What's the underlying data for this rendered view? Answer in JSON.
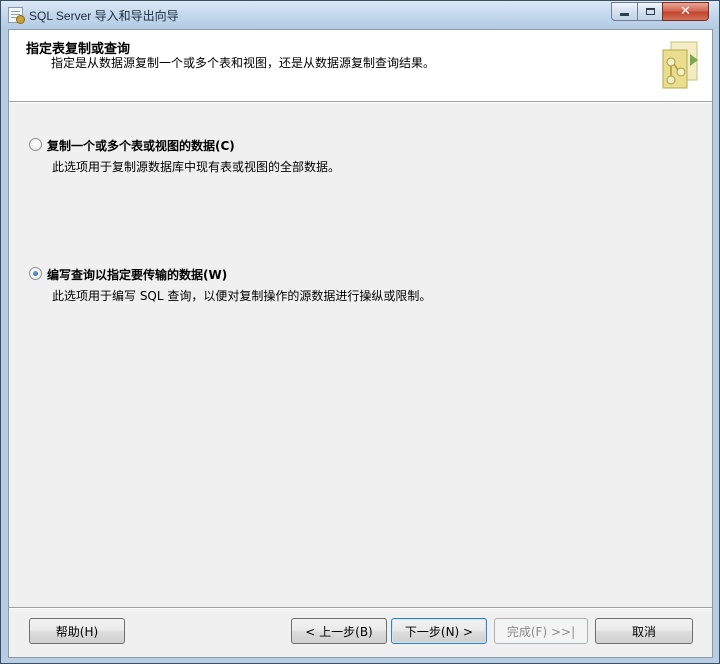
{
  "window": {
    "title": "SQL Server 导入和导出向导",
    "close_glyph": "✕"
  },
  "header": {
    "title": "指定表复制或查询",
    "description": "指定是从数据源复制一个或多个表和视图，还是从数据源复制查询结果。",
    "graphic_icon": "wizard-graphic-icon"
  },
  "options": [
    {
      "label": "复制一个或多个表或视图的数据(C)",
      "description": "此选项用于复制源数据库中现有表或视图的全部数据。",
      "selected": false
    },
    {
      "label": "编写查询以指定要传输的数据(W)",
      "description": "此选项用于编写 SQL 查询，以便对复制操作的源数据进行操纵或限制。",
      "selected": true
    }
  ],
  "buttons": {
    "help": "帮助(H)",
    "back": "< 上一步(B)",
    "next": "下一步(N) >",
    "finish": "完成(F) >>|",
    "cancel": "取消"
  },
  "colors": {
    "accent": "#3c7fb1",
    "close": "#c2452f",
    "graphic": "#d8cf7a"
  }
}
